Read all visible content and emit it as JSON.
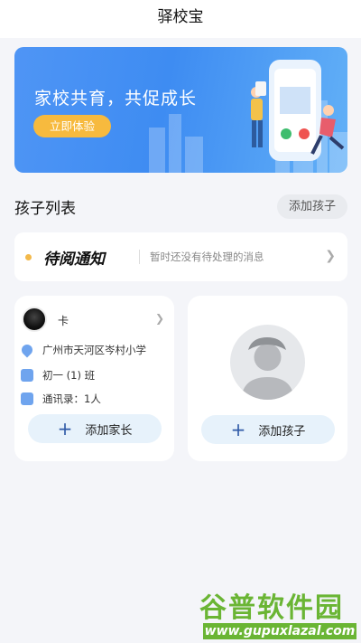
{
  "header": {
    "title": "驿校宝"
  },
  "banner": {
    "title": "家校共育，共促成长",
    "cta_label": "立即体验",
    "accent_color": "#3e8cf2",
    "cta_color": "#f7ba3e"
  },
  "children_section": {
    "title": "孩子列表",
    "add_child_label": "添加孩子"
  },
  "notice": {
    "title": "待阅通知",
    "description": "暂时还没有待处理的消息",
    "dot_color": "#f3b94a"
  },
  "child_card": {
    "name": "卡",
    "school": "广州市天河区岑村小学",
    "class": "初一 (1) 班",
    "contacts": "通讯录：1人",
    "add_parent_label": "添加家长"
  },
  "empty_card": {
    "add_child_label": "添加孩子"
  },
  "watermark": {
    "top": "谷普软件园",
    "bottom": "www.gupuxlazal.com"
  }
}
